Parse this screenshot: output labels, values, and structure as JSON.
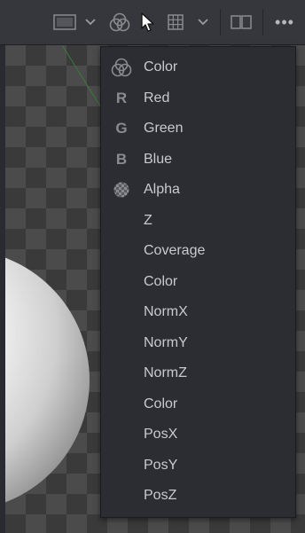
{
  "toolbar": {
    "icons": [
      "viewer-lut-icon",
      "chevron-down-icon",
      "channel-rgb-icon",
      "chevron-down-icon",
      "grid-icon",
      "chevron-down-icon",
      "split-view-icon",
      "more-options-icon"
    ],
    "more_label": "•••"
  },
  "channel_menu": {
    "items": [
      {
        "label": "Color",
        "icon": "rgb-circles-icon"
      },
      {
        "label": "Red",
        "icon": "R"
      },
      {
        "label": "Green",
        "icon": "G"
      },
      {
        "label": "Blue",
        "icon": "B"
      },
      {
        "label": "Alpha",
        "icon": "alpha-checker-icon"
      },
      {
        "label": "Z"
      },
      {
        "label": "Coverage"
      },
      {
        "label": "Color"
      },
      {
        "label": "NormX"
      },
      {
        "label": "NormY"
      },
      {
        "label": "NormZ"
      },
      {
        "label": "Color"
      },
      {
        "label": "PosX"
      },
      {
        "label": "PosY"
      },
      {
        "label": "PosZ"
      }
    ]
  },
  "colors": {
    "toolbar_bg": "#36373d",
    "menu_bg": "#2c2d33",
    "menu_text": "#c9cace",
    "icon": "#8a8b90"
  }
}
